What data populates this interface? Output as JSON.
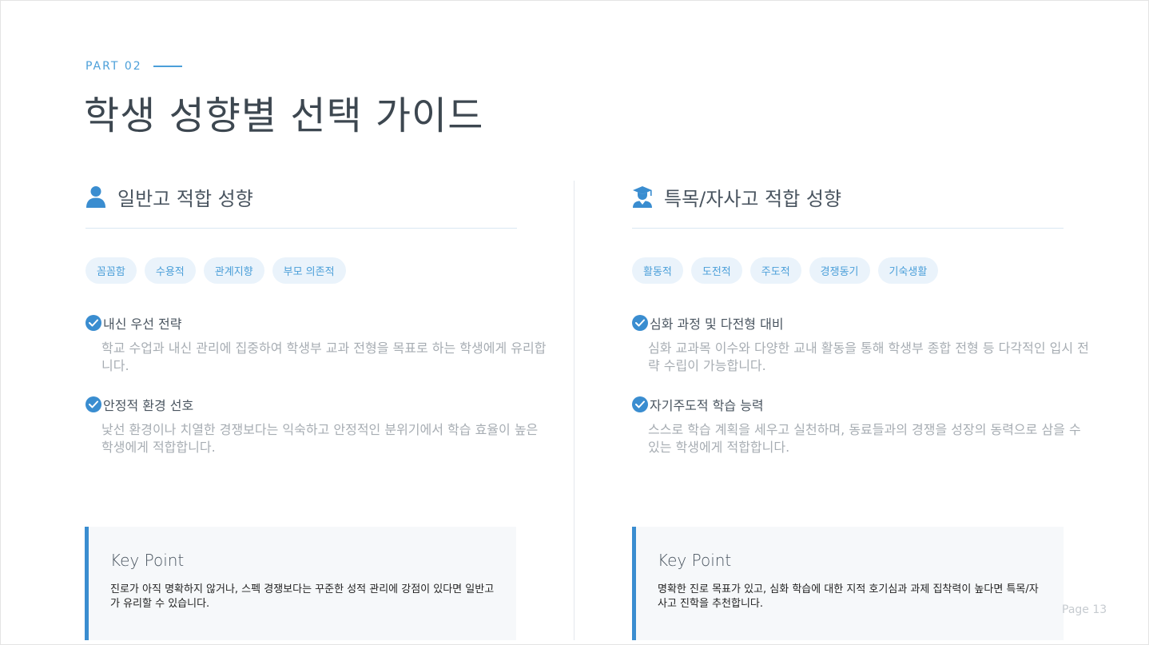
{
  "header": {
    "part_label": "PART 02",
    "title": "학생 성향별 선택 가이드"
  },
  "colors": {
    "accent": "#3a8dd0",
    "tag_bg": "#eaf3fb",
    "tag_text": "#4b9fd9",
    "box_bg": "#f6f8fa"
  },
  "left": {
    "icon": "user-icon",
    "title": "일반고 적합 성향",
    "tags": [
      "꼼꼼함",
      "수용적",
      "관계지향",
      "부모 의존적"
    ],
    "features": [
      {
        "title": "내신 우선 전략",
        "desc": "학교 수업과 내신 관리에 집중하여 학생부 교과 전형을 목표로 하는 학생에게 유리합니다."
      },
      {
        "title": "안정적 환경 선호",
        "desc": "낯선 환경이나 치열한 경쟁보다는 익숙하고 안정적인 분위기에서 학습 효율이 높은 학생에게 적합합니다."
      }
    ],
    "keypoint": {
      "title": "Key Point",
      "text": "진로가 아직 명확하지 않거나, 스펙 경쟁보다는 꾸준한 성적 관리에 강점이 있다면 일반고가 유리할 수 있습니다."
    }
  },
  "right": {
    "icon": "graduate-icon",
    "title": "특목/자사고 적합 성향",
    "tags": [
      "활동적",
      "도전적",
      "주도적",
      "경쟁동기",
      "기숙생활"
    ],
    "features": [
      {
        "title": "심화 과정 및 다전형 대비",
        "desc": "심화 교과목 이수와 다양한 교내 활동을 통해 학생부 종합 전형 등 다각적인 입시 전략 수립이 가능합니다."
      },
      {
        "title": "자기주도적 학습 능력",
        "desc": "스스로 학습 계획을 세우고 실천하며, 동료들과의 경쟁을 성장의 동력으로 삼을 수 있는 학생에게 적합합니다."
      }
    ],
    "keypoint": {
      "title": "Key Point",
      "text": "명확한 진로 목표가 있고, 심화 학습에 대한 지적 호기심과 과제 집착력이 높다면 특목/자사고 진학을 추천합니다."
    }
  },
  "footer": {
    "page": "Page 13"
  }
}
